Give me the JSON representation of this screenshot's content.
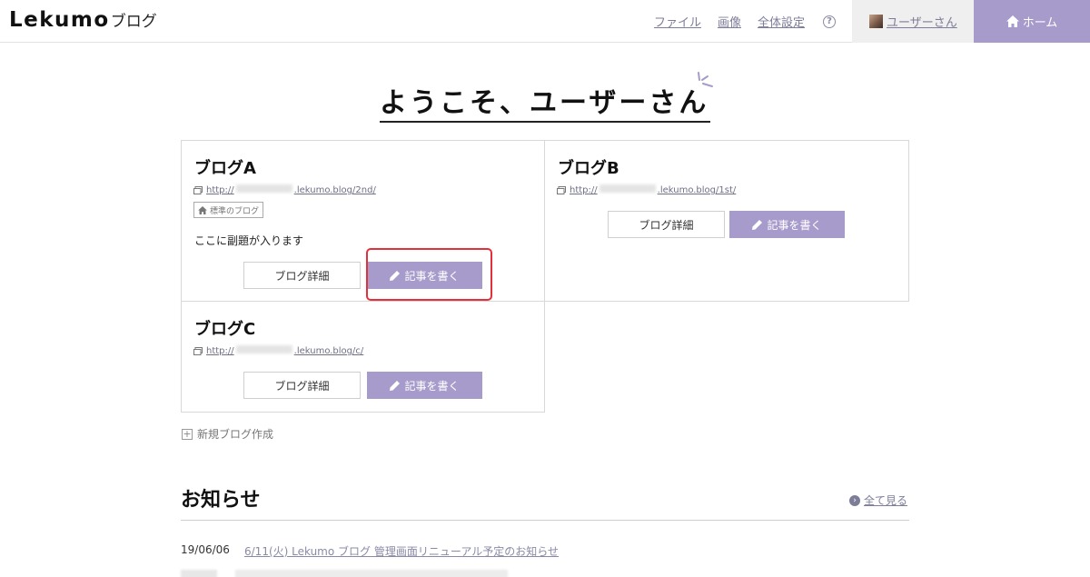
{
  "header": {
    "logo_brand": "Lekumo",
    "logo_sub": "ブログ",
    "nav": [
      "ファイル",
      "画像",
      "全体設定"
    ],
    "help_icon": "?",
    "user_name": "ユーザーさん",
    "home_label": "ホーム"
  },
  "welcome": "ようこそ、ユーザーさん",
  "blogs": [
    {
      "name": "ブログA",
      "url_prefix": "http://",
      "url_suffix": ".lekumo.blog/2nd/",
      "badge": "標準のブログ",
      "subtitle": "ここに副題が入ります",
      "detail_label": "ブログ詳細",
      "write_label": "記事を書く"
    },
    {
      "name": "ブログB",
      "url_prefix": "http://",
      "url_suffix": ".lekumo.blog/1st/",
      "detail_label": "ブログ詳細",
      "write_label": "記事を書く"
    },
    {
      "name": "ブログC",
      "url_prefix": "http://",
      "url_suffix": ".lekumo.blog/c/",
      "detail_label": "ブログ詳細",
      "write_label": "記事を書く"
    }
  ],
  "new_blog_label": "新規ブログ作成",
  "news": {
    "title": "お知らせ",
    "see_all": "全て見る",
    "items": [
      {
        "date": "19/06/06",
        "text": "6/11(火) Lekumo ブログ 管理画面リニューアル予定のお知らせ"
      }
    ]
  },
  "colors": {
    "accent": "#a69bcb",
    "highlight": "#e2313b",
    "link": "#7d7d9a"
  }
}
